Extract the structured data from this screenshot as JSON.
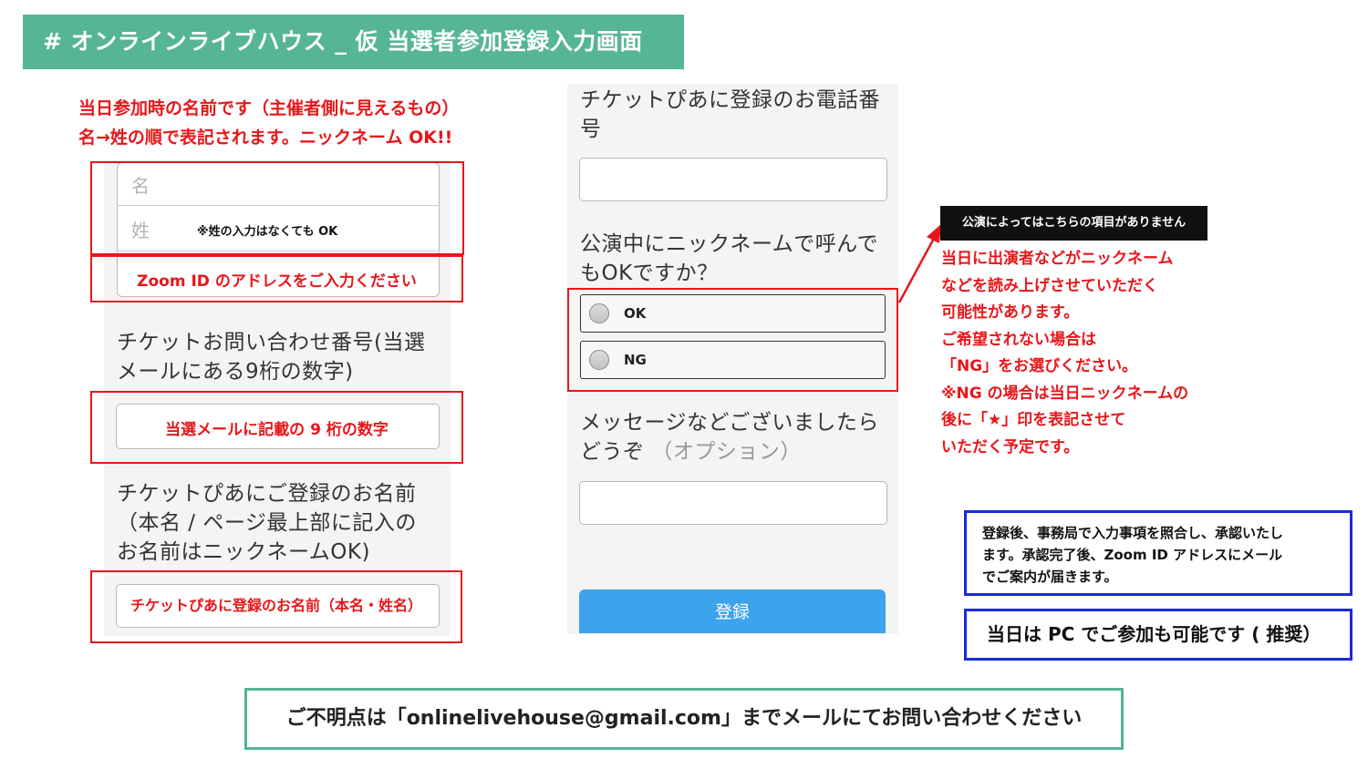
{
  "header": {
    "title": "# オンラインライブハウス _ 仮 当選者参加登録入力画面"
  },
  "left_notes": {
    "line1": "当日参加時の名前です（主催者側に見えるもの）",
    "line2": "名→姓の順で表記されます。ニックネーム OK!!"
  },
  "form_left": {
    "first_name_placeholder": "名",
    "last_name_placeholder": "姓",
    "last_name_note": "※姓の入力はなくても OK",
    "zoom_note": "Zoom ID のアドレスをご入力ください",
    "ticket_label_1": "チケットお問い合わせ番号(当選",
    "ticket_label_2": "メールにある9桁の数字)",
    "ticket_note": "当選メールに記載の 9 桁の数字",
    "pia_name_label_1": "チケットぴあにご登録のお名前",
    "pia_name_label_2": "（本名 / ページ最上部に記入の",
    "pia_name_label_3": "お名前はニックネームOK)",
    "pia_name_note": "チケットぴあに登録のお名前（本名・姓名）"
  },
  "form_right": {
    "phone_label_1": "チケットぴあに登録のお電話番",
    "phone_label_2": "号",
    "nickname_label_1": "公演中にニックネームで呼んで",
    "nickname_label_2": "もOKですか？",
    "options": [
      "OK",
      "NG"
    ],
    "message_label_1": "メッセージなどございましたら",
    "message_label_2": "どうぞ",
    "message_optional": "（オプション）",
    "submit_label": "登録"
  },
  "annotation": {
    "tag": "公演によってはこちらの項目がありません",
    "lines": [
      "当日に出演者などがニックネーム",
      "などを読み上げさせていただく",
      "可能性があります。",
      "ご希望されない場合は",
      "「NG」をお選びください。",
      "※NG の場合は当日ニックネームの",
      "後に「★」印を表記させて",
      "いただく予定です。"
    ]
  },
  "info_box": {
    "lines": [
      "登録後、事務局で入力事項を照合し、承認いたし",
      "ます。承認完了後、Zoom ID アドレスにメール",
      "でご案内が届きます。"
    ]
  },
  "pc_note": "当日は PC でご参加も可能です ( 推奨）",
  "contact": "ご不明点は「onlinelivehouse@gmail.com」までメールにてお問い合わせください",
  "colors": {
    "banner": "#55b596",
    "note_red": "#e8161a",
    "box_blue": "#1b2ad8",
    "button_blue": "#3da3ec"
  }
}
